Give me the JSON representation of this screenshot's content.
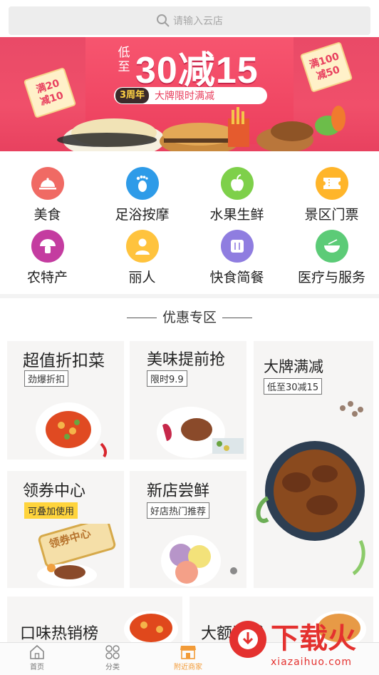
{
  "search": {
    "placeholder": "请输入云店"
  },
  "banner": {
    "prefix": "低至",
    "headline": "30减15",
    "anniv_badge": "3周年",
    "ribbon_text": "大牌限时满减",
    "left_tag": "满20减10",
    "right_tag": "满100减50",
    "colors": {
      "background": "#e94a67",
      "accent": "#ffd243"
    }
  },
  "categories": [
    {
      "label": "美食",
      "icon": "plate-icon",
      "color": "#f06a64"
    },
    {
      "label": "足浴按摩",
      "icon": "footprint-icon",
      "color": "#2e9be8"
    },
    {
      "label": "水果生鲜",
      "icon": "apple-icon",
      "color": "#7ed04a"
    },
    {
      "label": "景区门票",
      "icon": "ticket-icon",
      "color": "#ffb52a"
    },
    {
      "label": "农特产",
      "icon": "mushroom-icon",
      "color": "#c43ca0"
    },
    {
      "label": "丽人",
      "icon": "woman-icon",
      "color": "#ffc33d"
    },
    {
      "label": "快食简餐",
      "icon": "fast-food-icon",
      "color": "#8f7de0"
    },
    {
      "label": "医疗与服务",
      "icon": "bowl-icon",
      "color": "#5ccb77"
    }
  ],
  "promo": {
    "section_title": "优惠专区",
    "cards": [
      {
        "title": "超值折扣菜",
        "sub": "劲爆折扣"
      },
      {
        "title": "美味提前抢",
        "sub": "限时9.9"
      },
      {
        "title": "大牌满减",
        "sub": "低至30减15"
      },
      {
        "title": "领券中心",
        "sub": "可叠加使用",
        "stamp": "领券中心"
      },
      {
        "title": "新店尝鲜",
        "sub": "好店热门推荐"
      },
      {
        "title": "口味热销榜"
      },
      {
        "title": "大额满减"
      }
    ]
  },
  "bottom_nav": [
    {
      "label": "首页",
      "icon": "home-icon"
    },
    {
      "label": "分类",
      "icon": "grid-icon"
    },
    {
      "label": "附近商家",
      "icon": "store-icon",
      "active": true
    }
  ],
  "watermark": {
    "text": "下载火",
    "url": "xiazaihuo.com"
  }
}
